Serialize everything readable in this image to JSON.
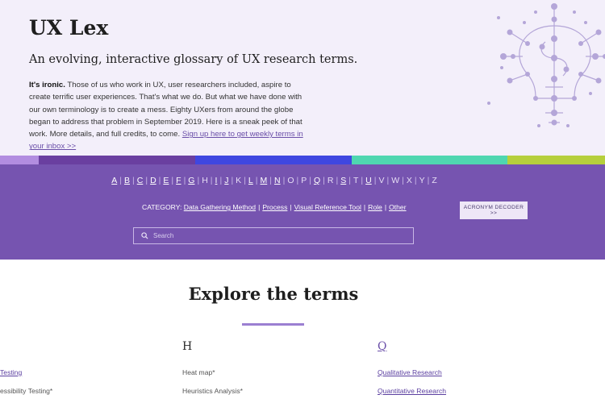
{
  "hero": {
    "title": "UX Lex",
    "tagline": "An evolving, interactive glossary of UX research terms.",
    "intro_bold": "It's ironic.",
    "intro_text": " Those of us who work in UX, user researchers included, aspire to create terrific user experiences. That's what we do. But what we have done with our own terminology is to create a mess. Eighty UXers from around the globe began to address that problem in September 2019. Here is a sneak peek of that work. More details, and full credits, to come. ",
    "signup_link": "Sign up here to get weekly terms in your inbox >>"
  },
  "stripes": [
    "#b28de0",
    "#6a3fa0",
    "#3f47e0",
    "#4fd6b0",
    "#b6cf3c"
  ],
  "alphabet": [
    {
      "l": "A",
      "on": true
    },
    {
      "l": "B",
      "on": true
    },
    {
      "l": "C",
      "on": true
    },
    {
      "l": "D",
      "on": true
    },
    {
      "l": "E",
      "on": true
    },
    {
      "l": "F",
      "on": true
    },
    {
      "l": "G",
      "on": true
    },
    {
      "l": "H",
      "on": false
    },
    {
      "l": "I",
      "on": true
    },
    {
      "l": "J",
      "on": true
    },
    {
      "l": "K",
      "on": false
    },
    {
      "l": "L",
      "on": true
    },
    {
      "l": "M",
      "on": true
    },
    {
      "l": "N",
      "on": true
    },
    {
      "l": "O",
      "on": false
    },
    {
      "l": "P",
      "on": false
    },
    {
      "l": "Q",
      "on": true
    },
    {
      "l": "R",
      "on": false
    },
    {
      "l": "S",
      "on": true
    },
    {
      "l": "T",
      "on": false
    },
    {
      "l": "U",
      "on": true
    },
    {
      "l": "V",
      "on": false
    },
    {
      "l": "W",
      "on": false
    },
    {
      "l": "X",
      "on": false
    },
    {
      "l": "Y",
      "on": false
    },
    {
      "l": "Z",
      "on": false
    }
  ],
  "category": {
    "label": "CATEGORY:",
    "items": [
      "Data Gathering Method",
      "Process",
      "Visual Reference Tool",
      "Role",
      "Other"
    ]
  },
  "acronym_button": "ACRONYM DECODER >>",
  "search": {
    "placeholder": "Search"
  },
  "explore": {
    "title": "Explore the terms"
  },
  "columns": {
    "h": {
      "heading": "H",
      "terms": [
        "Heat map*",
        "Heuristics Analysis*"
      ]
    },
    "q": {
      "heading": "Q",
      "terms": [
        "Qualitative Research",
        "Quantitative Research"
      ]
    },
    "a": {
      "terms": [
        "Testing",
        "essibility Testing*"
      ]
    }
  },
  "colors": {
    "nav_bg": "#7654b0",
    "hero_bg": "#f3effa",
    "link": "#5b3fa0",
    "accent": "#9b7fd1"
  }
}
